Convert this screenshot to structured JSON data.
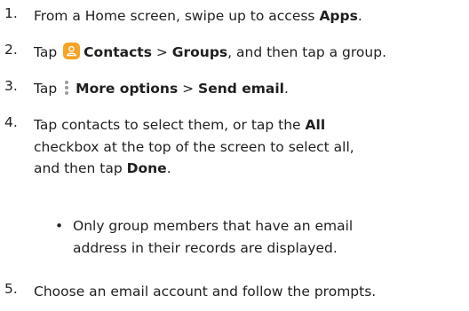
{
  "steps": [
    {
      "number": "1.",
      "pre": "From a Home screen, swipe up to access ",
      "bold1": "Apps",
      "post": "."
    },
    {
      "number": "2.",
      "pre": "Tap ",
      "bold1": "Contacts",
      "sep": " > ",
      "bold2": "Groups",
      "post": ", and then tap a group."
    },
    {
      "number": "3.",
      "pre": "Tap ",
      "bold1": "More options",
      "sep": " > ",
      "bold2": "Send email",
      "post": "."
    },
    {
      "number": "4.",
      "line1_pre": "Tap contacts to select them, or tap the ",
      "line1_bold": "All",
      "line2": "checkbox at the top of the screen to select all,",
      "line3_pre": "and then tap ",
      "line3_bold": "Done",
      "line3_post": ".",
      "bullet_symbol": "•",
      "bullet_line1": "Only group members that have an email",
      "bullet_line2": "address in their records are displayed."
    },
    {
      "number": "5.",
      "text": "Choose an email account and follow the prompts."
    }
  ],
  "icons": {
    "contacts": "contacts-app-icon",
    "contacts_color": "#f7a325",
    "more": "more-options-icon"
  }
}
